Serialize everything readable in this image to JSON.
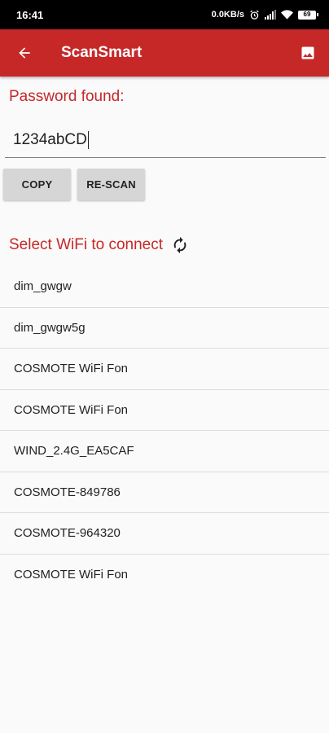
{
  "status_bar": {
    "time": "16:41",
    "net_speed": "0.0KB/s",
    "battery": "69"
  },
  "app_bar": {
    "title": "ScanSmart",
    "back_icon": "arrow-left-icon",
    "gallery_icon": "image-icon"
  },
  "password": {
    "label": "Password found:",
    "value": "1234abCD"
  },
  "buttons": {
    "copy": "COPY",
    "rescan": "RE-SCAN"
  },
  "wifi": {
    "heading": "Select WiFi to connect",
    "refresh_icon": "refresh-icon",
    "networks": [
      "dim_gwgw",
      "dim_gwgw5g",
      "COSMOTE WiFi Fon",
      "COSMOTE WiFi Fon",
      "WIND_2.4G_EA5CAF",
      "COSMOTE-849786",
      "COSMOTE-964320",
      "COSMOTE WiFi Fon"
    ]
  },
  "colors": {
    "accent": "#c62828",
    "button": "#d6d6d6",
    "background": "#fafafa"
  }
}
